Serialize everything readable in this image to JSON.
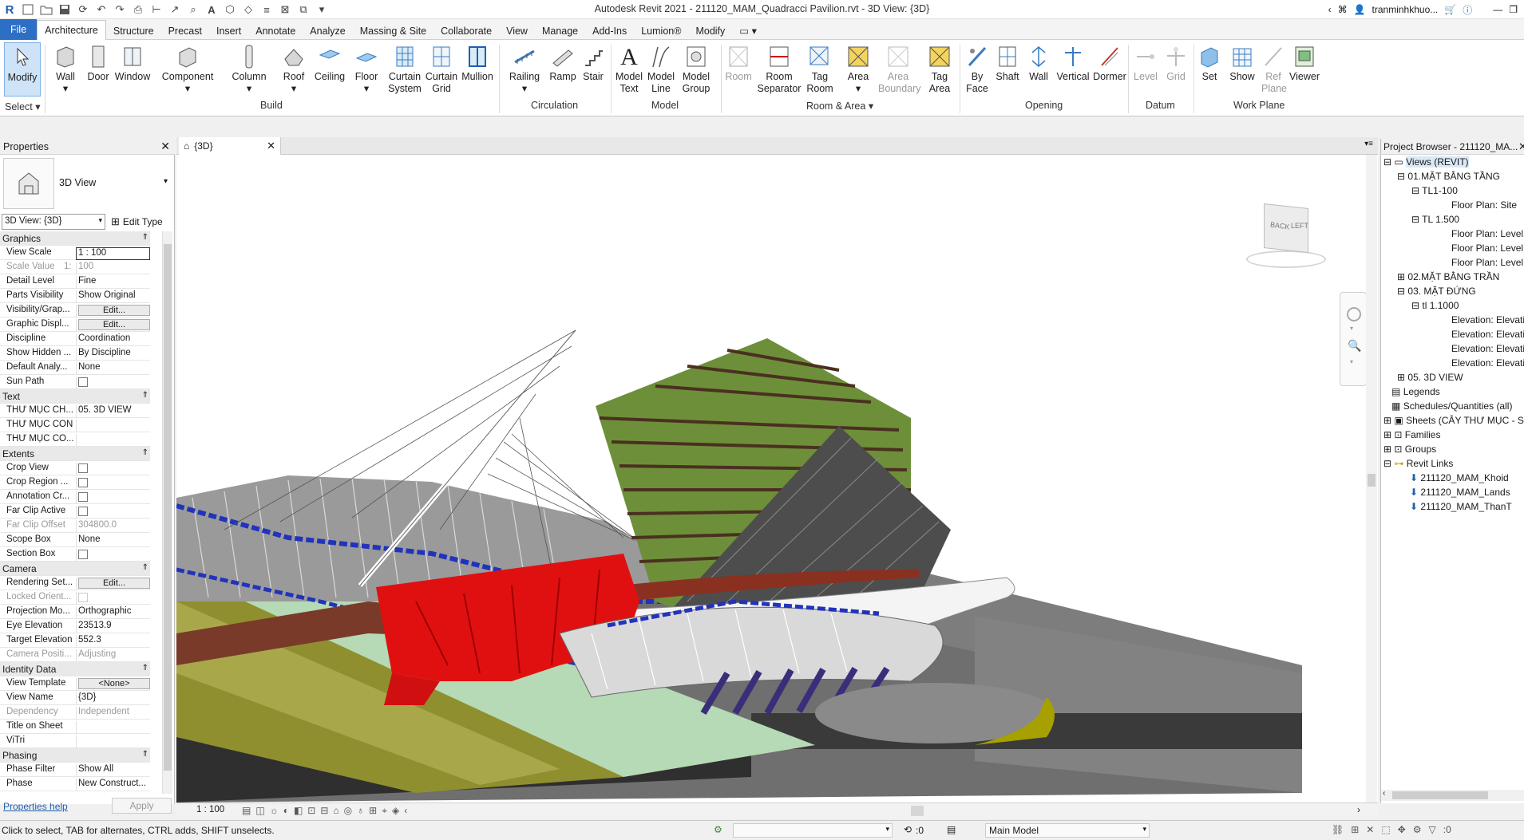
{
  "app": {
    "title": "Autodesk Revit 2021 - 211120_MAM_Quadracci Pavilion.rvt - 3D View: {3D}",
    "user": "tranminhkhuo..."
  },
  "menu": {
    "file": "File",
    "tabs": [
      "Architecture",
      "Structure",
      "Precast",
      "Insert",
      "Annotate",
      "Analyze",
      "Massing & Site",
      "Collaborate",
      "View",
      "Manage",
      "Add-Ins",
      "Lumion®",
      "Modify"
    ]
  },
  "ribbon": {
    "buttons": {
      "modify": "Modify",
      "wall": "Wall",
      "door": "Door",
      "window": "Window",
      "component": "Component",
      "column": "Column",
      "roof": "Roof",
      "ceiling": "Ceiling",
      "floor": "Floor",
      "curtain_system": "Curtain System",
      "curtain_grid": "Curtain Grid",
      "mullion": "Mullion",
      "railing": "Railing",
      "ramp": "Ramp",
      "stair": "Stair",
      "model_text": "Model Text",
      "model_line": "Model Line",
      "model_group": "Model Group",
      "room": "Room",
      "room_separator": "Room Separator",
      "tag_room": "Tag Room",
      "area": "Area",
      "area_boundary": "Area Boundary",
      "tag_area": "Tag Area",
      "by_face": "By Face",
      "shaft": "Shaft",
      "wall_opening": "Wall",
      "vertical": "Vertical",
      "dormer": "Dormer",
      "level": "Level",
      "grid": "Grid",
      "set": "Set",
      "show": "Show",
      "ref_plane": "Ref Plane",
      "viewer": "Viewer"
    },
    "panels": {
      "select": "Select",
      "build": "Build",
      "circulation": "Circulation",
      "model": "Model",
      "room_area": "Room & Area",
      "opening": "Opening",
      "datum": "Datum",
      "work_plane": "Work Plane"
    }
  },
  "properties": {
    "title": "Properties",
    "type_name": "3D View",
    "selector": "3D View: {3D}",
    "edit_type": "Edit Type",
    "help": "Properties help",
    "apply": "Apply"
  },
  "prop_rows": {
    "graphics": "Graphics",
    "view_scale": [
      "View Scale",
      "1 : 100"
    ],
    "scale_value": [
      "Scale Value",
      "1:",
      "100"
    ],
    "detail_level": [
      "Detail Level",
      "Fine"
    ],
    "parts_visibility": [
      "Parts Visibility",
      "Show Original"
    ],
    "visibility_graph": [
      "Visibility/Grap...",
      "Edit..."
    ],
    "graphic_display": [
      "Graphic Displ...",
      "Edit..."
    ],
    "discipline": [
      "Discipline",
      "Coordination"
    ],
    "show_hidden": [
      "Show Hidden ...",
      "By Discipline"
    ],
    "default_analysis": [
      "Default Analy...",
      "None"
    ],
    "sun_path": [
      "Sun Path",
      ""
    ],
    "text": "Text",
    "thu_muc_ch": [
      "THƯ MỤC CH...",
      "05. 3D VIEW"
    ],
    "thu_muc_con": [
      "THƯ MỤC CON",
      ""
    ],
    "thu_muc_co": [
      "THƯ MỤC CO...",
      ""
    ],
    "extents": "Extents",
    "crop_view": [
      "Crop View",
      ""
    ],
    "crop_region": [
      "Crop Region ...",
      ""
    ],
    "annotation_crop": [
      "Annotation Cr...",
      ""
    ],
    "far_clip_active": [
      "Far Clip Active",
      ""
    ],
    "far_clip_offset": [
      "Far Clip Offset",
      "304800.0"
    ],
    "scope_box": [
      "Scope Box",
      "None"
    ],
    "section_box": [
      "Section Box",
      ""
    ],
    "camera": "Camera",
    "rendering_settings": [
      "Rendering Set...",
      "Edit..."
    ],
    "locked_orient": [
      "Locked Orient...",
      ""
    ],
    "projection_mode": [
      "Projection Mo...",
      "Orthographic"
    ],
    "eye_elevation": [
      "Eye Elevation",
      "23513.9"
    ],
    "target_elevation": [
      "Target Elevation",
      "552.3"
    ],
    "camera_position": [
      "Camera Positi...",
      "Adjusting"
    ],
    "identity": "Identity Data",
    "view_template": [
      "View Template",
      "<None>"
    ],
    "view_name": [
      "View Name",
      "{3D}"
    ],
    "dependency": [
      "Dependency",
      "Independent"
    ],
    "title_on_sheet": [
      "Title on Sheet",
      ""
    ],
    "vitri": [
      "ViTri",
      ""
    ],
    "phasing": "Phasing",
    "phase_filter": [
      "Phase Filter",
      "Show All"
    ],
    "phase": [
      "Phase",
      "New Construct..."
    ]
  },
  "view": {
    "tab": "{3D}",
    "scale": "1 : 100",
    "viewcube_back": "BACK",
    "viewcube_left": "LEFT"
  },
  "browser": {
    "title": "Project Browser - 211120_MA...",
    "nodes": {
      "views": "Views (REVIT)",
      "mat_bang_tang": "01.MẶT BẰNG TẦNG",
      "tl1_100": "TL1-100",
      "fp_site": "Floor Plan: Site",
      "tl1_500": "TL 1.500",
      "fp_level1": "Floor Plan: Level",
      "fp_level2": "Floor Plan: Level ",
      "fp_level3": "Floor Plan: Level ",
      "mat_bang_tran": "02.MẶT BẰNG TRẦN",
      "mat_dung": "03. MẶT ĐỨNG",
      "tl1_1000": "tl 1.1000",
      "elev1": "Elevation: Elevatio",
      "elev2": "Elevation: Elevatio",
      "elev3": "Elevation: Elevatio",
      "elev4": "Elevation: Elevatio",
      "view3d": "05. 3D VIEW",
      "legends": "Legends",
      "schedules": "Schedules/Quantities (all)",
      "sheets": "Sheets (CÂY THƯ MỤC - S",
      "families": "Families",
      "groups": "Groups",
      "revit_links": "Revit Links",
      "link1": "211120_MAM_Khoid",
      "link2": "211120_MAM_Lands",
      "link3": "211120_MAM_ThanT"
    }
  },
  "status": {
    "hint": "Click to select, TAB for alternates, CTRL adds, SHIFT unselects.",
    "worksets_count": ":0",
    "model": "Main Model",
    "filter_count": ":0"
  }
}
